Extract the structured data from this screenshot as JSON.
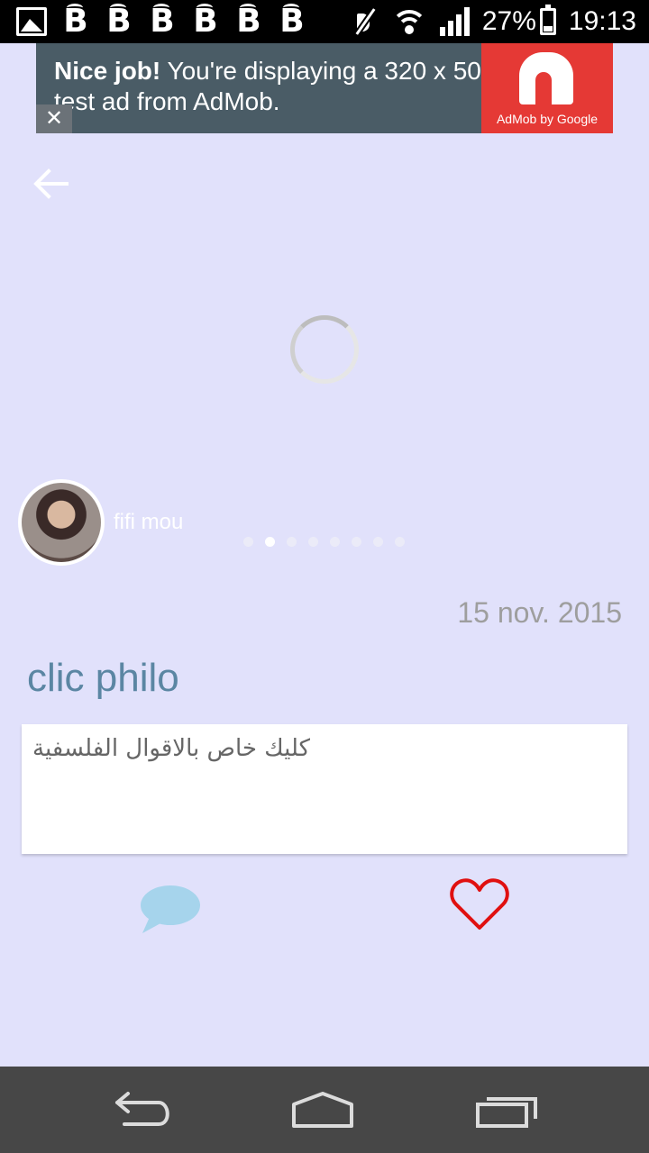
{
  "status_bar": {
    "battery": "27%",
    "battery_level": 0.27,
    "time": "19:13",
    "notification_icons": [
      "gallery-icon",
      "b-app-icon",
      "b-app-icon",
      "b-app-icon",
      "b-app-icon",
      "b-app-icon",
      "b-app-icon"
    ]
  },
  "ad": {
    "bold": "Nice job!",
    "text": " You're displaying a 320 x 50 test ad from AdMob.",
    "logo_label": "AdMob by Google",
    "close": "✕"
  },
  "post": {
    "author": "fifi mou",
    "date": "15 nov. 2015",
    "title": "clic philo",
    "body": "كليك خاص بالاقوال الفلسفية",
    "pager_count": 8,
    "pager_active": 1
  },
  "colors": {
    "background": "#e1e1fb",
    "title": "#5b86a3",
    "comment": "#a6d4ec",
    "heart": "#e01010"
  }
}
